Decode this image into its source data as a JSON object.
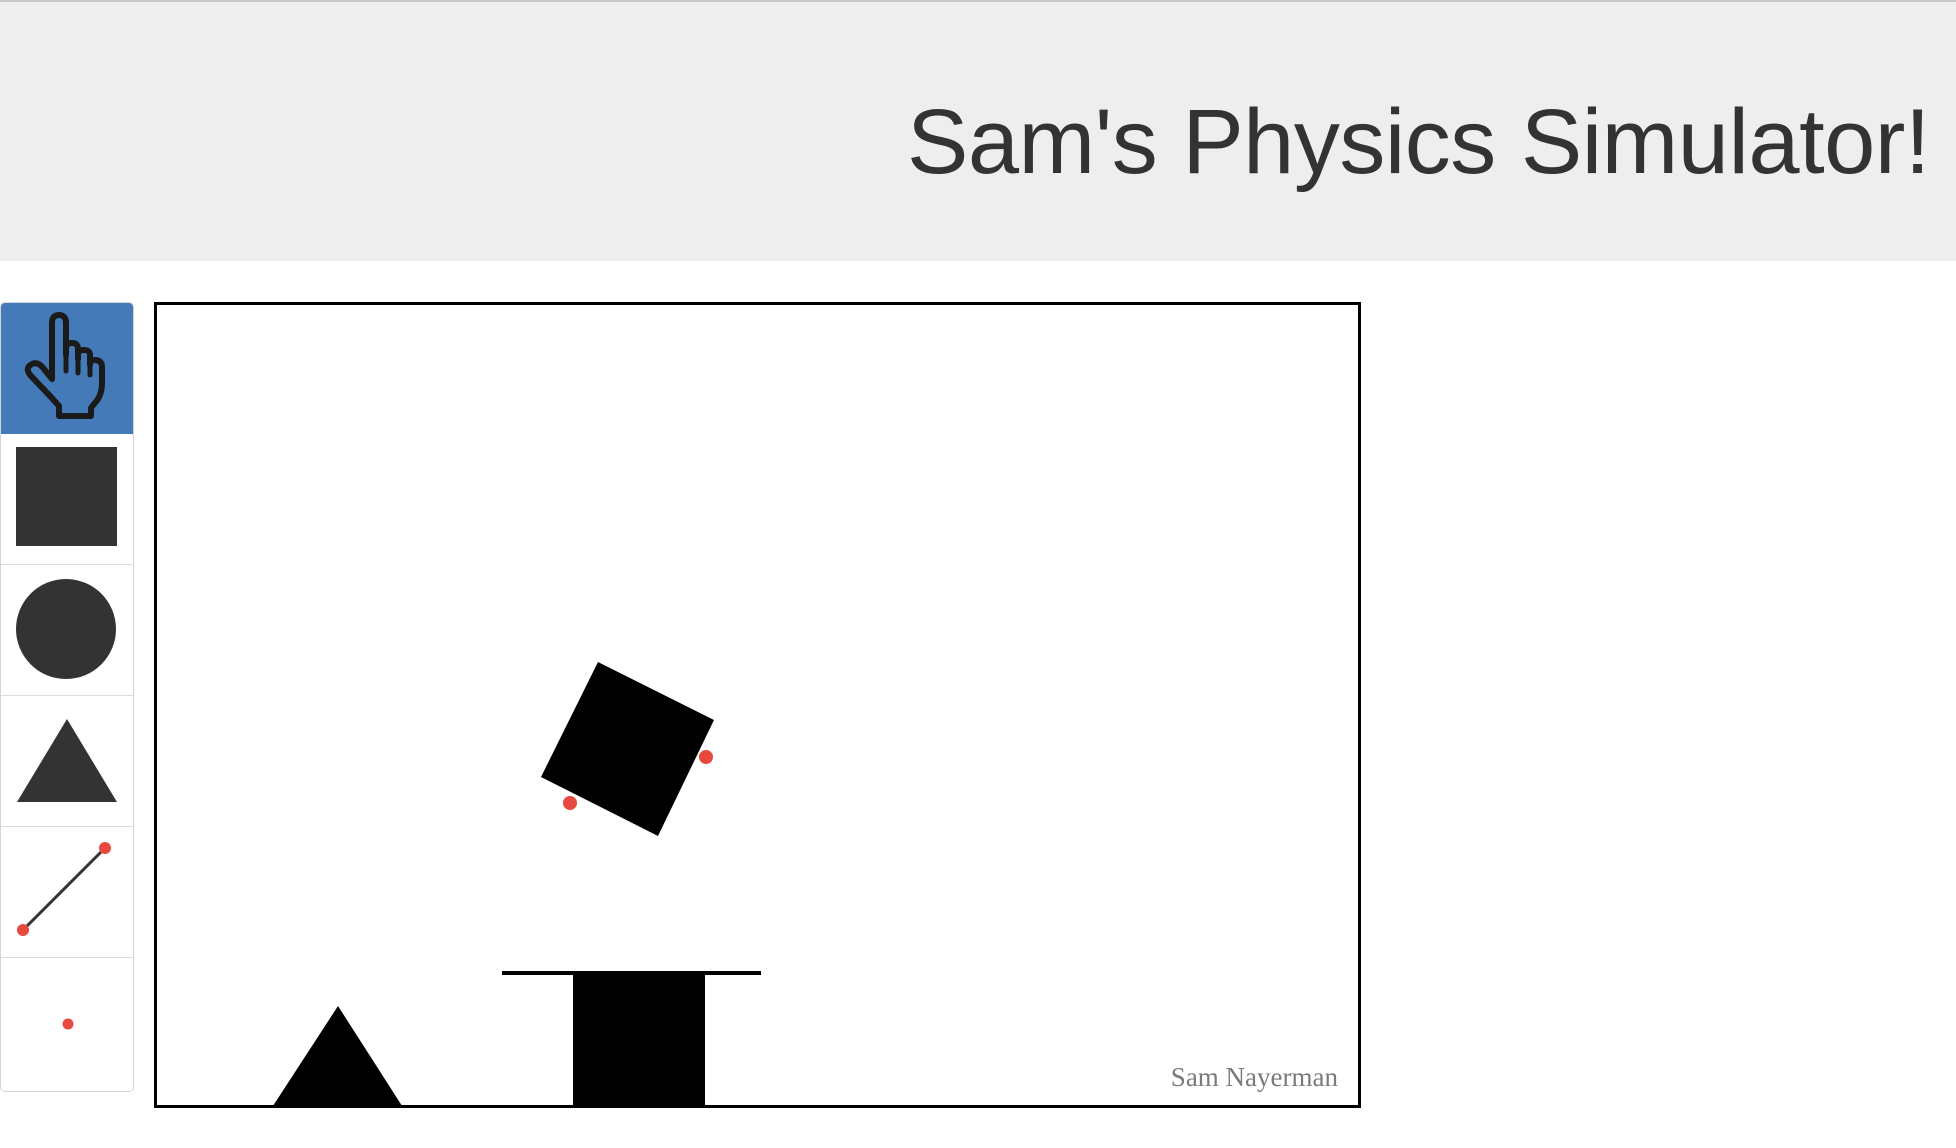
{
  "header": {
    "title": "Sam's Physics Simulator!"
  },
  "toolbar": {
    "active_color": "#447ab8",
    "tools": [
      {
        "name": "hand-tool",
        "icon": "hand-pointer-icon",
        "active": true
      },
      {
        "name": "box-tool",
        "icon": "square-icon",
        "active": false
      },
      {
        "name": "circle-tool",
        "icon": "circle-icon",
        "active": false
      },
      {
        "name": "triangle-tool",
        "icon": "triangle-icon",
        "active": false
      },
      {
        "name": "line-tool",
        "icon": "line-segment-icon",
        "active": false
      },
      {
        "name": "point-tool",
        "icon": "dot-icon",
        "active": false
      }
    ]
  },
  "canvas": {
    "credit": "Sam Nayerman",
    "shape_color": "#000000",
    "joint_color": "#e8493e",
    "icon_color": "#333333"
  }
}
